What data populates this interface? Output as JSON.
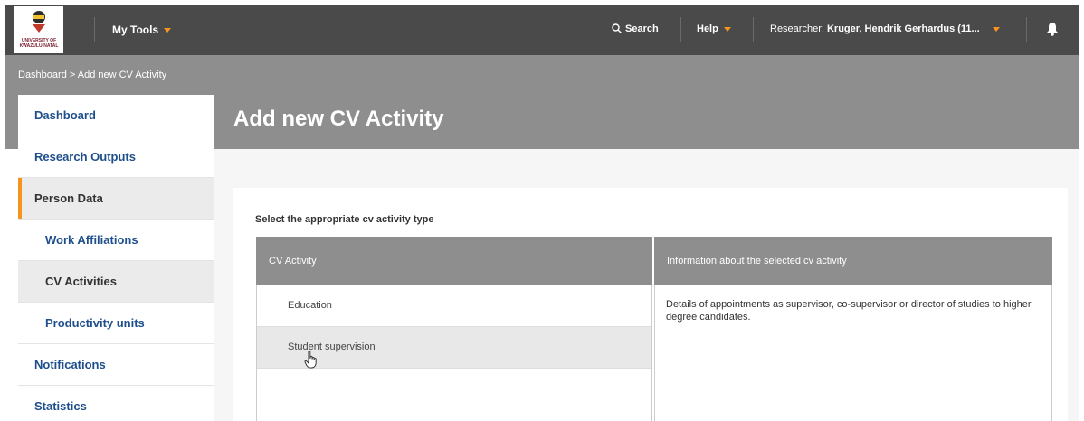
{
  "header": {
    "university_lines": [
      "UNIVERSITY OF",
      "KWAZULU-NATAL"
    ],
    "my_tools": "My Tools",
    "search": "Search",
    "help": "Help",
    "researcher_prefix": "Researcher:",
    "researcher_name": "Kruger, Hendrik Gerhardus (11...",
    "accent_color": "#f7941d"
  },
  "breadcrumb": "Dashboard > Add new CV Activity",
  "page_title": "Add new CV Activity",
  "sidebar": {
    "items": [
      {
        "label": "Dashboard"
      },
      {
        "label": "Research Outputs"
      },
      {
        "label": "Person Data"
      },
      {
        "label": "Work Affiliations"
      },
      {
        "label": "CV Activities"
      },
      {
        "label": "Productivity units"
      },
      {
        "label": "Notifications"
      },
      {
        "label": "Statistics"
      }
    ]
  },
  "form": {
    "label": "Select the appropriate cv activity type",
    "columns": [
      "CV Activity",
      "Information about the selected cv activity"
    ],
    "activities": [
      "Education",
      "Student supervision"
    ],
    "selected_info": "Details of appointments as supervisor, co-supervisor or director of studies to higher degree candidates."
  }
}
